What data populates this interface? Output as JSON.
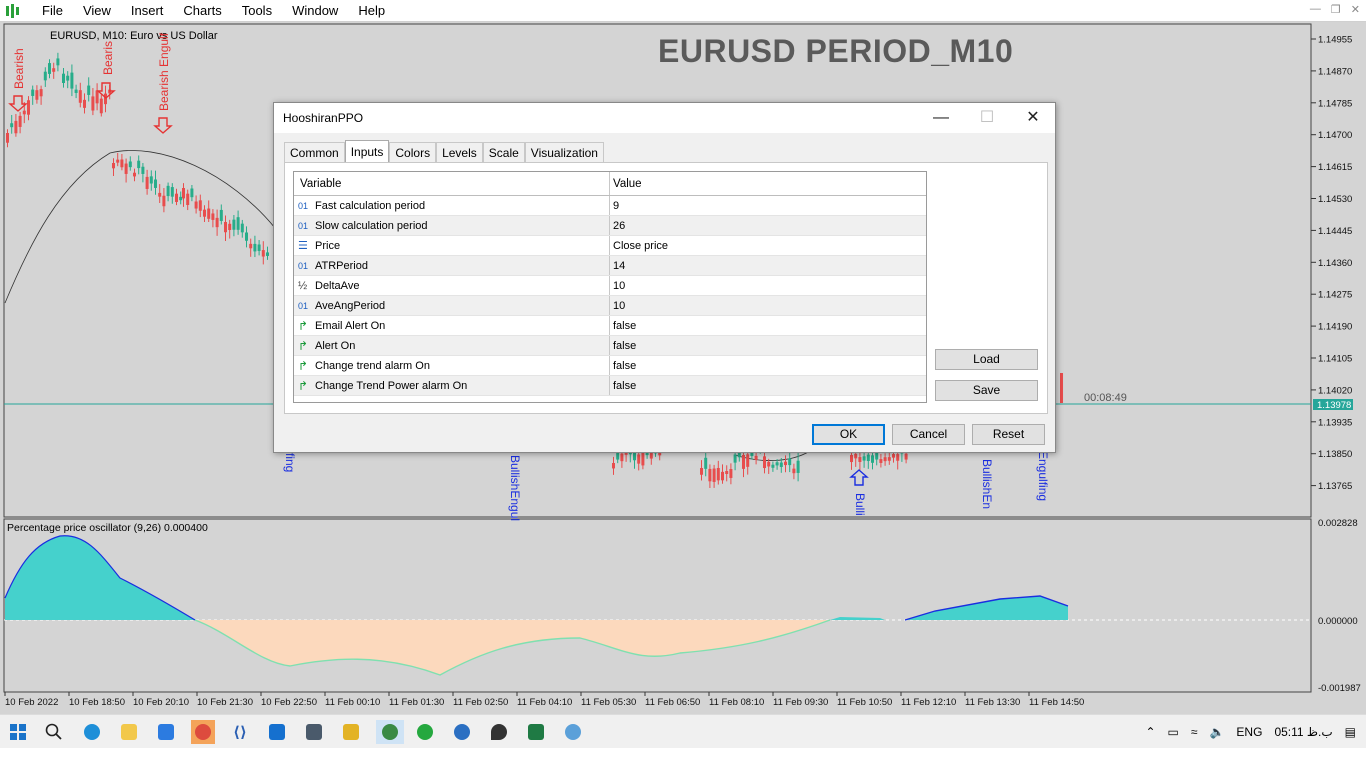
{
  "menu": {
    "items": [
      "File",
      "View",
      "Insert",
      "Charts",
      "Tools",
      "Window",
      "Help"
    ]
  },
  "chart": {
    "window_title": "EURUSD, M10:  Euro vs US Dollar",
    "big_title": "EURUSD   PERIOD_M10",
    "timer": "00:08:49",
    "current_price": "1.13978",
    "price_axis": [
      "1.14955",
      "1.14870",
      "1.14785",
      "1.14700",
      "1.14615",
      "1.14530",
      "1.14445",
      "1.14360",
      "1.14275",
      "1.14190",
      "1.14105",
      "1.14020",
      "1.13935",
      "1.13850",
      "1.13765"
    ],
    "signals": {
      "bearish_1": "Bearish",
      "bearish_2": "Bearis",
      "bearish_3": "Bearish Engulf",
      "bull_1": "fing",
      "bull_2": "BullishEngul",
      "bull_3": "Bulli",
      "bull_4": "BullishEn",
      "bull_5": "Engulfing"
    },
    "colors": {
      "bull_candle": "#27ad8a",
      "bear_candle": "#e84d4d",
      "ppo_positive_fill": "#45d1cc",
      "ppo_negative_fill": "#fcd9bd",
      "bid_line": "#26a69a"
    }
  },
  "ppo": {
    "title": "Percentage price oscillator (9,26) 0.000400",
    "axis": [
      "0.002828",
      "0.000000",
      "-0.001987"
    ]
  },
  "time_axis": [
    "10 Feb 2022",
    "10 Feb 18:50",
    "10 Feb 20:10",
    "10 Feb 21:30",
    "10 Feb 22:50",
    "11 Feb 00:10",
    "11 Feb 01:30",
    "11 Feb 02:50",
    "11 Feb 04:10",
    "11 Feb 05:30",
    "11 Feb 06:50",
    "11 Feb 08:10",
    "11 Feb 09:30",
    "11 Feb 10:50",
    "11 Feb 12:10",
    "11 Feb 13:30",
    "11 Feb 14:50"
  ],
  "dialog": {
    "title": "HooshiranPPO",
    "tabs": [
      "Common",
      "Inputs",
      "Colors",
      "Levels",
      "Scale",
      "Visualization"
    ],
    "active_tab": "Inputs",
    "col_variable": "Variable",
    "col_value": "Value",
    "rows": [
      {
        "icon": "int-icon",
        "name": "Fast calculation period",
        "value": "9"
      },
      {
        "icon": "int-icon",
        "name": "Slow calculation period",
        "value": "26"
      },
      {
        "icon": "enum-icon",
        "name": "Price",
        "value": "Close price"
      },
      {
        "icon": "int-icon",
        "name": "ATRPeriod",
        "value": "14"
      },
      {
        "icon": "double-icon",
        "name": "DeltaAve",
        "value": "10"
      },
      {
        "icon": "int-icon",
        "name": "AveAngPeriod",
        "value": "10"
      },
      {
        "icon": "bool-icon",
        "name": "Email Alert On",
        "value": "false"
      },
      {
        "icon": "bool-icon",
        "name": "Alert On",
        "value": "false"
      },
      {
        "icon": "bool-icon",
        "name": "Change trend alarm On",
        "value": "false"
      },
      {
        "icon": "bool-icon",
        "name": "Change Trend Power alarm On",
        "value": "false"
      }
    ],
    "load": "Load",
    "save": "Save",
    "ok": "OK",
    "cancel": "Cancel",
    "reset": "Reset"
  },
  "taskbar": {
    "lang": "ENG",
    "clock": "05:11 ب.ظ"
  }
}
